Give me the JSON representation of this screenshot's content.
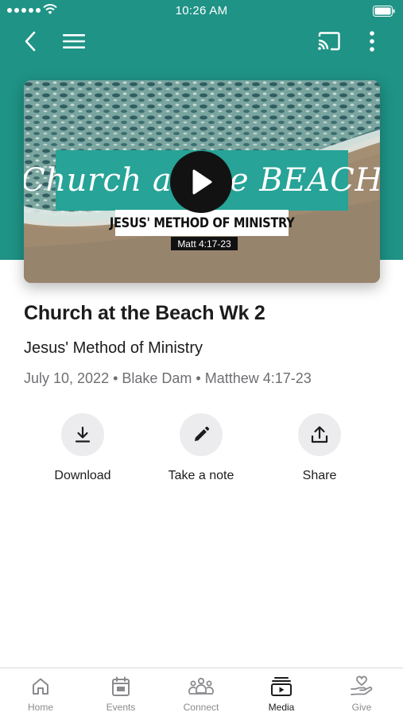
{
  "status_bar": {
    "time": "10:26 AM"
  },
  "media": {
    "thumbnail": {
      "banner_text": "Church at the BEACH",
      "subtitle_text": "JESUS' METHOD OF MINISTRY",
      "verse_text": "Matt 4:17-23"
    },
    "title": "Church at the Beach Wk 2",
    "subtitle": "Jesus' Method of Ministry",
    "meta": "July 10, 2022 • Blake Dam • Matthew 4:17-23"
  },
  "actions": [
    {
      "label": "Download",
      "icon": "download-icon"
    },
    {
      "label": "Take a note",
      "icon": "pencil-icon"
    },
    {
      "label": "Share",
      "icon": "share-icon"
    }
  ],
  "tabs": [
    {
      "label": "Home",
      "icon": "home-icon",
      "active": false
    },
    {
      "label": "Events",
      "icon": "calendar-icon",
      "active": false
    },
    {
      "label": "Connect",
      "icon": "people-icon",
      "active": false
    },
    {
      "label": "Media",
      "icon": "media-player-icon",
      "active": true
    },
    {
      "label": "Give",
      "icon": "hand-heart-icon",
      "active": false
    }
  ],
  "colors": {
    "header_teal": "#1f9386",
    "banner_teal": "#27a397",
    "action_circle": "#ececee",
    "inactive_tab": "#8a8a8e",
    "active_tab": "#1c1c1e"
  }
}
